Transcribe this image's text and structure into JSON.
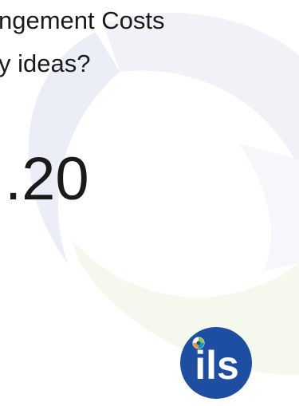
{
  "slide": {
    "title_line_1": "ngement Costs",
    "title_line_2": "y ideas?",
    "big_number": ".20",
    "logo_text": "ils"
  },
  "colors": {
    "background": "#ffffff",
    "text": "#1a1a1a",
    "logo_blue": "#1e4ea1",
    "swirl_blue": "#e9ecf6",
    "swirl_green": "#f3f7e8"
  }
}
